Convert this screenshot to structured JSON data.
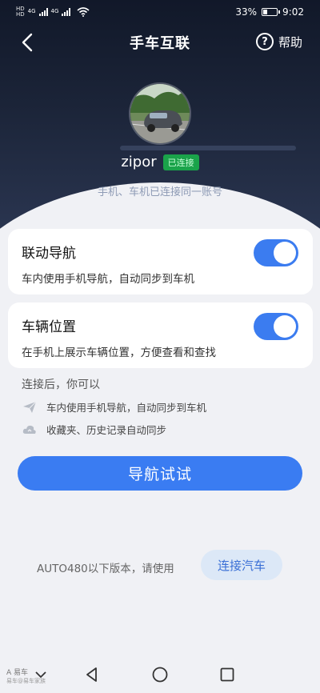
{
  "status_bar": {
    "network_labels": [
      "HD",
      "HD"
    ],
    "net_type_1": "4G",
    "net_type_2": "4G",
    "battery_percent": "33%",
    "battery_level": 0.33,
    "time": "9:02"
  },
  "header": {
    "back_icon": "chevron-left-icon",
    "title": "手车互联",
    "help_label": "帮助",
    "help_icon": "question-circle-icon"
  },
  "profile": {
    "username": "zipor",
    "status_badge": "已连接",
    "hint": "手机、车机已连接同一账号"
  },
  "settings": [
    {
      "title": "联动导航",
      "description": "车内使用手机导航，自动同步到车机",
      "enabled": true
    },
    {
      "title": "车辆位置",
      "description": "在手机上展示车辆位置，方便查看和查找",
      "enabled": true
    }
  ],
  "features": {
    "heading": "连接后，你可以",
    "items": [
      {
        "icon": "paper-plane-icon",
        "text": "车内使用手机导航，自动同步到车机"
      },
      {
        "icon": "cloud-icon",
        "text": "收藏夹、历史记录自动同步"
      }
    ]
  },
  "actions": {
    "primary_label": "导航试试",
    "legacy_text": "AUTO480以下版本，请使用",
    "connect_label": "连接汽车"
  },
  "system_nav": {
    "buttons": [
      "chevron-down-icon",
      "back-triangle-icon",
      "home-circle-icon",
      "recents-square-icon"
    ]
  },
  "watermark": {
    "line1": "A 易车",
    "line2": "易车@易车家族"
  },
  "colors": {
    "accent": "#3a7cf2",
    "badge_green": "#1aa34a",
    "hero_dark": "#111829"
  }
}
